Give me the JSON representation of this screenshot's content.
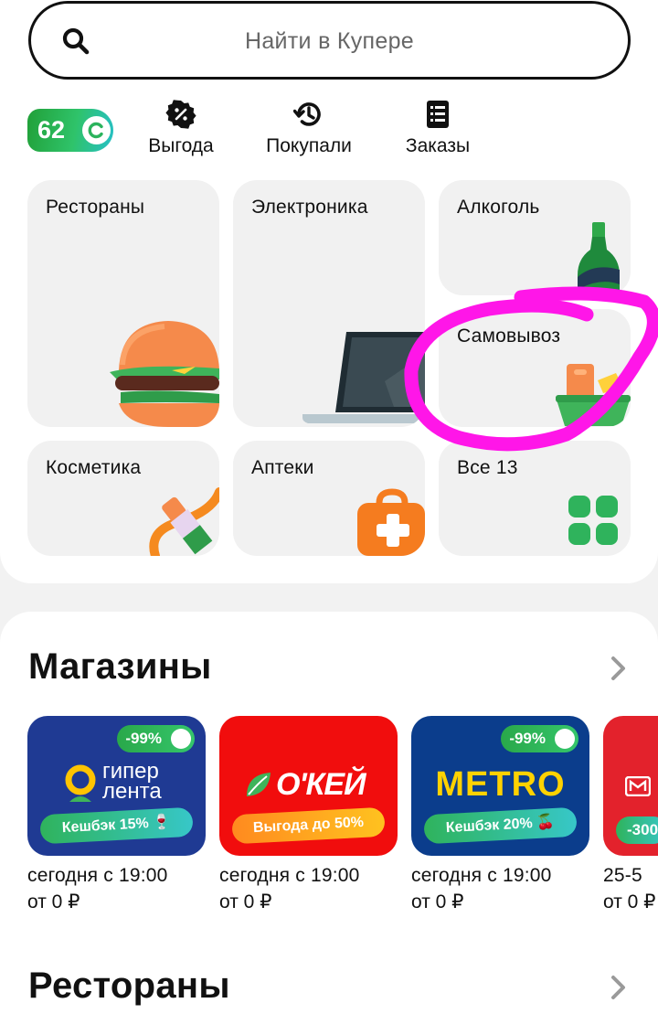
{
  "search": {
    "placeholder": "Найти в Купере"
  },
  "bonus": {
    "points": "62"
  },
  "quick_actions": [
    {
      "label": "Выгода",
      "icon": "discount-badge-icon"
    },
    {
      "label": "Покупали",
      "icon": "history-icon"
    },
    {
      "label": "Заказы",
      "icon": "orders-list-icon"
    }
  ],
  "categories": [
    {
      "label": "Рестораны",
      "icon": "burger-icon"
    },
    {
      "label": "Электроника",
      "icon": "laptop-icon"
    },
    {
      "label": "Алкоголь",
      "icon": "wine-bottle-icon"
    },
    {
      "label": "Самовывоз",
      "icon": "pickup-basket-icon"
    },
    {
      "label": "Косметика",
      "icon": "lipstick-icon"
    },
    {
      "label": "Аптеки",
      "icon": "first-aid-bag-icon"
    },
    {
      "label": "Все 13",
      "icon": "grid-icon"
    }
  ],
  "sections": {
    "stores_title": "Магазины",
    "restaurants_title": "Рестораны"
  },
  "stores": [
    {
      "name": "гипер лента",
      "logo_top": "гипер",
      "logo_bottom": "лента",
      "discount": "-99%",
      "promo": "Кешбэк 15% 🍷",
      "time": "сегодня с 19:00",
      "price": "от 0 ₽",
      "color": "#1f3a93"
    },
    {
      "name": "О'КЕЙ",
      "logo": "О'КЕЙ",
      "promo": "Выгода до 50%",
      "time": "сегодня с 19:00",
      "price": "от 0 ₽",
      "color": "#f10d0d"
    },
    {
      "name": "METRO",
      "logo": "METRO",
      "discount": "-99%",
      "promo": "Кешбэк 20% 🍒",
      "time": "сегодня с 19:00",
      "price": "от 0 ₽",
      "color": "#0b3d8c"
    },
    {
      "name": "Магнит",
      "discount": "-300",
      "time": "25-5",
      "price": "от 0 ₽",
      "color": "#e3222c"
    }
  ],
  "colors": {
    "accent_green": "#21a038",
    "highlight_magenta": "#ff16e8"
  }
}
